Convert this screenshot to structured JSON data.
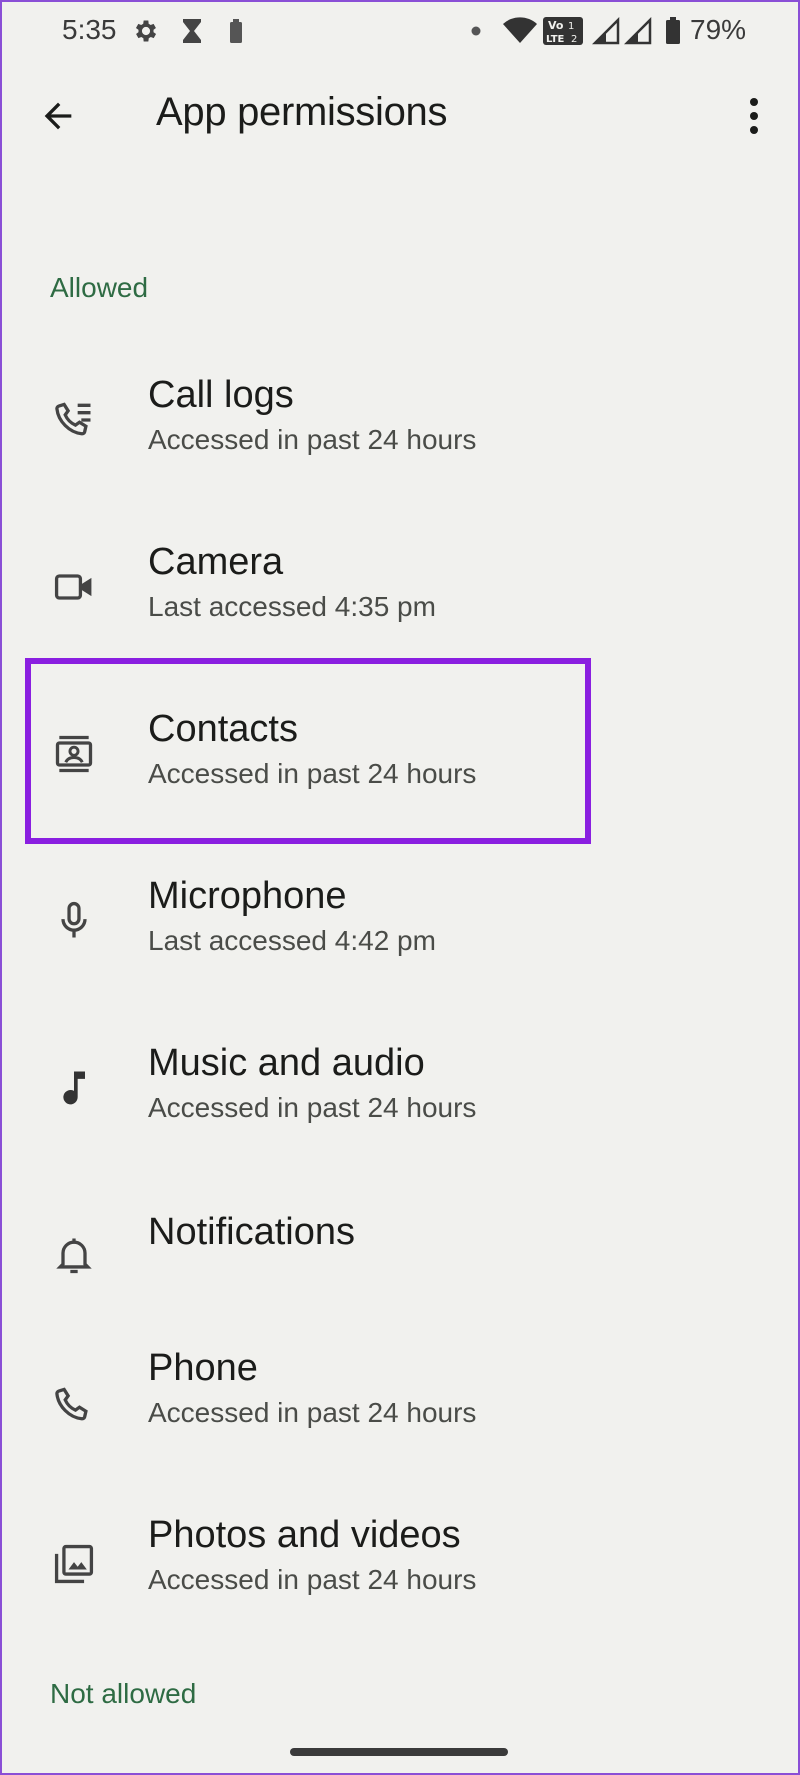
{
  "status_bar": {
    "time": "5:35",
    "battery_percent": "79%",
    "icons": [
      "gear-icon",
      "hourglass-icon",
      "battery-small-icon",
      "dot-icon",
      "wifi-icon",
      "volte-icon",
      "signal-icon",
      "signal-icon",
      "battery-icon"
    ]
  },
  "app_bar": {
    "title": "App permissions",
    "back_icon": "arrow-back-icon",
    "more_icon": "more-vert-icon"
  },
  "sections": {
    "allowed": {
      "header": "Allowed",
      "items": [
        {
          "title": "Call logs",
          "subtitle": "Accessed in past 24 hours",
          "icon": "call-log-icon"
        },
        {
          "title": "Camera",
          "subtitle": "Last accessed 4:35 pm",
          "icon": "camera-icon"
        },
        {
          "title": "Contacts",
          "subtitle": "Accessed in past 24 hours",
          "icon": "contacts-icon",
          "highlighted": true
        },
        {
          "title": "Microphone",
          "subtitle": "Last accessed 4:42 pm",
          "icon": "microphone-icon"
        },
        {
          "title": "Music and audio",
          "subtitle": "Accessed in past 24 hours",
          "icon": "music-note-icon"
        },
        {
          "title": "Notifications",
          "subtitle": "",
          "icon": "bell-icon"
        },
        {
          "title": "Phone",
          "subtitle": "Accessed in past 24 hours",
          "icon": "phone-icon"
        },
        {
          "title": "Photos and videos",
          "subtitle": "Accessed in past 24 hours",
          "icon": "photos-icon"
        }
      ]
    },
    "not_allowed": {
      "header": "Not allowed"
    }
  },
  "colors": {
    "background": "#f1f1ee",
    "section_header": "#2e6b43",
    "highlight": "#8a1fe0",
    "frame": "#8a4fd6"
  }
}
